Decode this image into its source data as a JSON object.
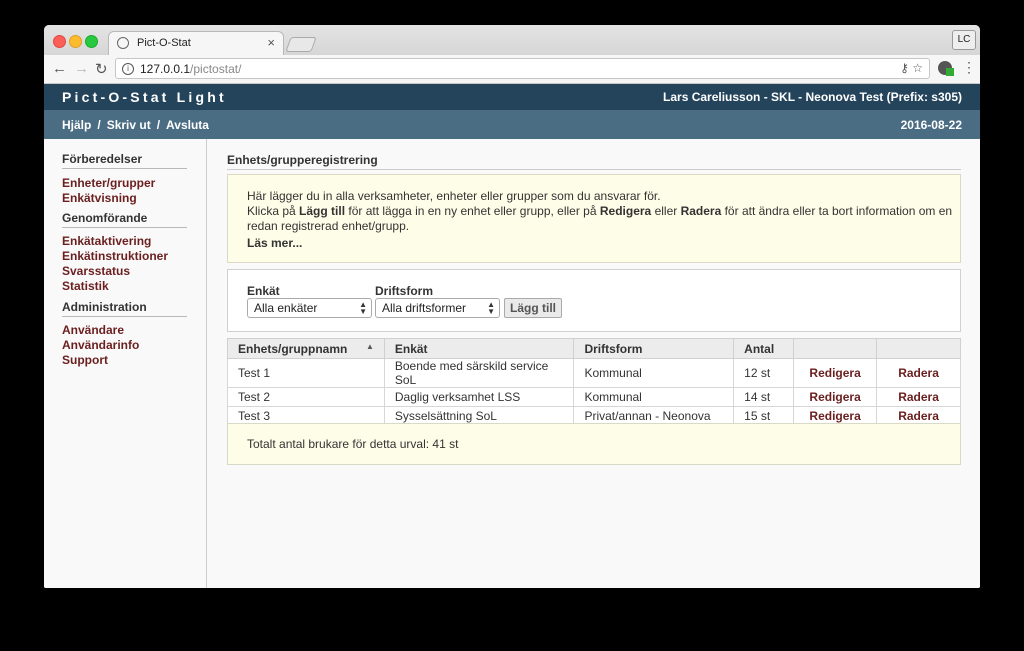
{
  "browser": {
    "tab_title": "Pict-O-Stat",
    "url_host": "127.0.0.1",
    "url_path": "/pictostat/",
    "profile_initials": "LC"
  },
  "header": {
    "brand": "Pict-O-Stat Light",
    "user": "Lars Careliusson - SKL - Neonova Test (Prefix: s305)"
  },
  "subnav": {
    "help": "Hjälp",
    "print": "Skriv ut",
    "quit": "Avsluta",
    "separator": "/",
    "date": "2016-08-22"
  },
  "sidebar": {
    "sections": [
      {
        "heading": "Förberedelser",
        "items": [
          "Enheter/grupper",
          "Enkätvisning"
        ]
      },
      {
        "heading": "Genomförande",
        "items": [
          "Enkätaktivering",
          "Enkätinstruktioner",
          "Svarsstatus",
          "Statistik"
        ]
      },
      {
        "heading": "Administration",
        "items": [
          "Användare",
          "Användarinfo",
          "Support"
        ]
      }
    ]
  },
  "main": {
    "title": "Enhets/grupperegistrering",
    "info": {
      "line1": "Här lägger du in alla verksamheter, enheter eller grupper som du ansvarar för.",
      "line2_a": "Klicka på ",
      "line2_b": "Lägg till",
      "line2_c": " för att lägga in en ny enhet eller grupp, eller på ",
      "line2_d": "Redigera",
      "line2_e": " eller ",
      "line2_f": "Radera",
      "line2_g": " för att ändra eller ta bort information om en",
      "line3": "redan registrerad enhet/grupp.",
      "read_more": "Läs mer..."
    },
    "filters": {
      "survey_label": "Enkät",
      "survey_value": "Alla enkäter",
      "operation_label": "Driftsform",
      "operation_value": "Alla driftsformer",
      "add_button": "Lägg till"
    },
    "table": {
      "headers": [
        "Enhets/gruppnamn",
        "Enkät",
        "Driftsform",
        "Antal",
        "",
        ""
      ],
      "rows": [
        [
          "Test 1",
          "Boende med särskild service SoL",
          "Kommunal",
          "12 st",
          "Redigera",
          "Radera"
        ],
        [
          "Test 2",
          "Daglig verksamhet LSS",
          "Kommunal",
          "14 st",
          "Redigera",
          "Radera"
        ],
        [
          "Test 3",
          "Sysselsättning SoL",
          "Privat/annan - Neonova",
          "15 st",
          "Redigera",
          "Radera"
        ]
      ]
    },
    "total": "Totalt antal brukare för detta urval: 41 st"
  }
}
